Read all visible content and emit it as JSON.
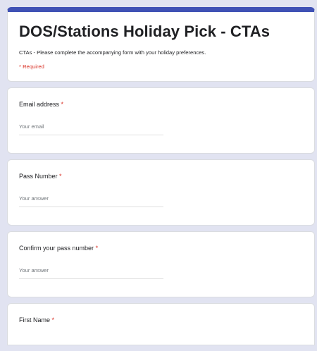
{
  "form": {
    "title": "DOS/Stations Holiday Pick - CTAs",
    "description": "CTAs - Please complete the accompanying form with your holiday preferences.",
    "required_note": "* Required"
  },
  "questions": [
    {
      "label": "Email address",
      "required_mark": "*",
      "placeholder": "Your email"
    },
    {
      "label": "Pass Number",
      "required_mark": "*",
      "placeholder": "Your answer"
    },
    {
      "label": "Confirm your pass number",
      "required_mark": "*",
      "placeholder": "Your answer"
    },
    {
      "label": "First Name",
      "required_mark": "*"
    }
  ],
  "colors": {
    "accent": "#3f51b5",
    "background": "#e1e3f1",
    "required": "#d93025"
  }
}
